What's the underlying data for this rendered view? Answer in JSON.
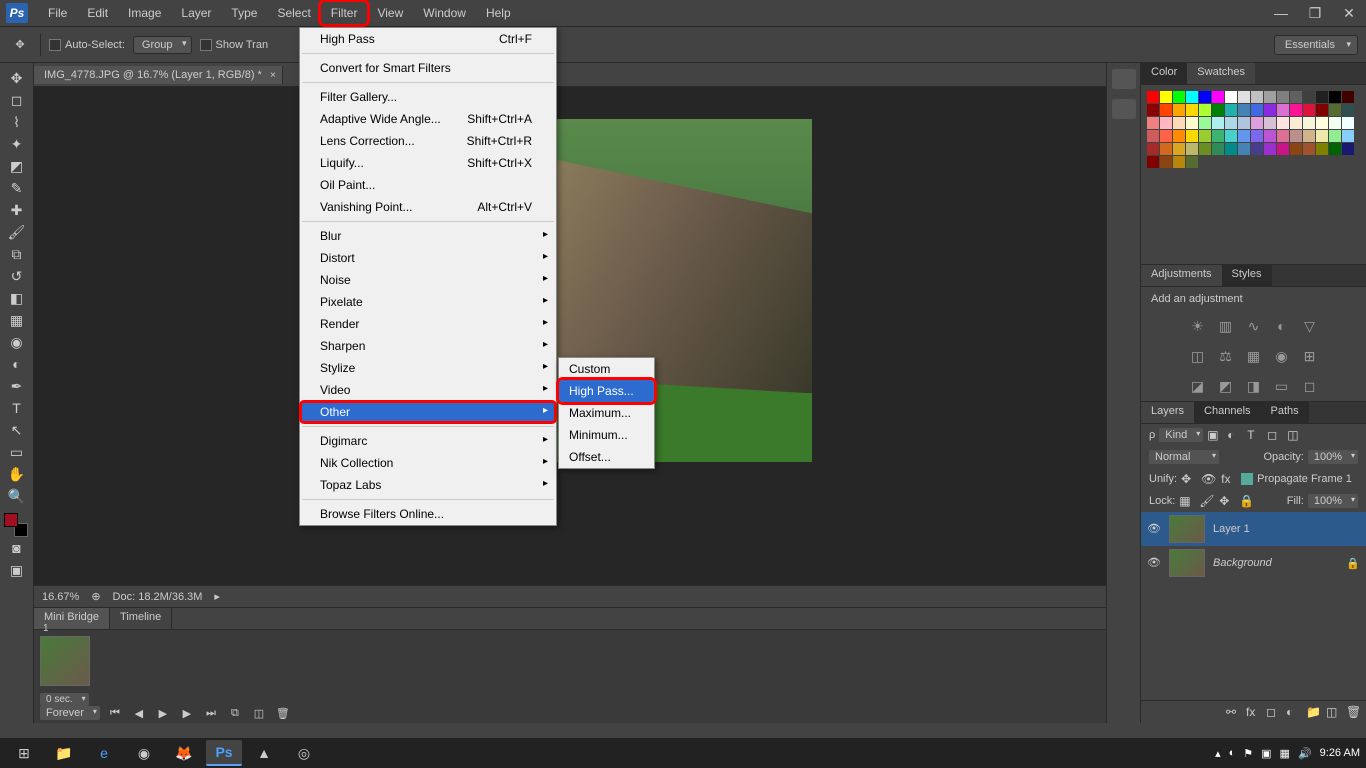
{
  "menubar": {
    "items": [
      "File",
      "Edit",
      "Image",
      "Layer",
      "Type",
      "Select",
      "Filter",
      "View",
      "Window",
      "Help"
    ],
    "highlighted_index": 6
  },
  "brand": "Ps",
  "options": {
    "auto_select": "Auto-Select:",
    "group": "Group",
    "show_trans": "Show Tran",
    "workspace": "Essentials"
  },
  "doc_tab": "IMG_4778.JPG @ 16.7% (Layer 1, RGB/8) *",
  "status": {
    "zoom": "16.67%",
    "doc": "Doc: 18.2M/36.3M"
  },
  "bottom_panel": {
    "tabs": [
      "Mini Bridge",
      "Timeline"
    ],
    "active": 1,
    "sec_label": "0 sec.",
    "forever": "Forever"
  },
  "filter_menu": {
    "top": {
      "label": "High Pass",
      "shortcut": "Ctrl+F"
    },
    "convert": "Convert for Smart Filters",
    "group2": [
      {
        "label": "Filter Gallery...",
        "shortcut": ""
      },
      {
        "label": "Adaptive Wide Angle...",
        "shortcut": "Shift+Ctrl+A"
      },
      {
        "label": "Lens Correction...",
        "shortcut": "Shift+Ctrl+R"
      },
      {
        "label": "Liquify...",
        "shortcut": "Shift+Ctrl+X"
      },
      {
        "label": "Oil Paint...",
        "shortcut": ""
      },
      {
        "label": "Vanishing Point...",
        "shortcut": "Alt+Ctrl+V"
      }
    ],
    "group3": [
      "Blur",
      "Distort",
      "Noise",
      "Pixelate",
      "Render",
      "Sharpen",
      "Stylize",
      "Video",
      "Other"
    ],
    "group4": [
      "Digimarc",
      "Nik Collection",
      "Topaz Labs"
    ],
    "browse": "Browse Filters Online..."
  },
  "submenu": {
    "items": [
      "Custom",
      "High Pass...",
      "Maximum...",
      "Minimum...",
      "Offset..."
    ],
    "hover_index": 1
  },
  "panels": {
    "color_tabs": [
      "Color",
      "Swatches"
    ],
    "adj_tabs": [
      "Adjustments",
      "Styles"
    ],
    "adj_text": "Add an adjustment",
    "layer_tabs": [
      "Layers",
      "Channels",
      "Paths"
    ],
    "kind": "Kind",
    "blend": "Normal",
    "opacity_label": "Opacity:",
    "opacity_val": "100%",
    "unify": "Unify:",
    "propagate": "Propagate Frame 1",
    "lock": "Lock:",
    "fill_label": "Fill:",
    "fill_val": "100%",
    "layers": [
      {
        "name": "Layer 1",
        "italic": false,
        "selected": true
      },
      {
        "name": "Background",
        "italic": true,
        "selected": false
      }
    ]
  },
  "swatch_colors": [
    "#ff0000",
    "#ffff00",
    "#00ff00",
    "#00ffff",
    "#0000ff",
    "#ff00ff",
    "#ffffff",
    "#e0e0e0",
    "#c0c0c0",
    "#a0a0a0",
    "#808080",
    "#606060",
    "#404040",
    "#202020",
    "#000000",
    "#400000",
    "#8b0000",
    "#ff4500",
    "#ffa500",
    "#ffd700",
    "#adff2f",
    "#008000",
    "#20b2aa",
    "#4682b4",
    "#4169e1",
    "#8a2be2",
    "#da70d6",
    "#ff1493",
    "#dc143c",
    "#800000",
    "#556b2f",
    "#2f4f4f",
    "#f08080",
    "#ffb6c1",
    "#ffdab9",
    "#fffacd",
    "#98fb98",
    "#afeeee",
    "#add8e6",
    "#b0c4de",
    "#dda0dd",
    "#d8bfd8",
    "#ffe4e1",
    "#faebd7",
    "#f5f5dc",
    "#ffffe0",
    "#f0fff0",
    "#f0ffff",
    "#cd5c5c",
    "#ff6347",
    "#ff8c00",
    "#ffd700",
    "#9acd32",
    "#3cb371",
    "#48d1cc",
    "#6495ed",
    "#7b68ee",
    "#ba55d3",
    "#db7093",
    "#bc8f8f",
    "#d2b48c",
    "#eee8aa",
    "#90ee90",
    "#87cefa",
    "#a52a2a",
    "#d2691e",
    "#daa520",
    "#bdb76b",
    "#6b8e23",
    "#2e8b57",
    "#008b8b",
    "#4682b4",
    "#483d8b",
    "#9932cc",
    "#c71585",
    "#8b4513",
    "#a0522d",
    "#808000",
    "#006400",
    "#191970",
    "#800000",
    "#8b4513",
    "#b8860b",
    "#556b2f"
  ],
  "taskbar": {
    "time": "9:26 AM"
  }
}
